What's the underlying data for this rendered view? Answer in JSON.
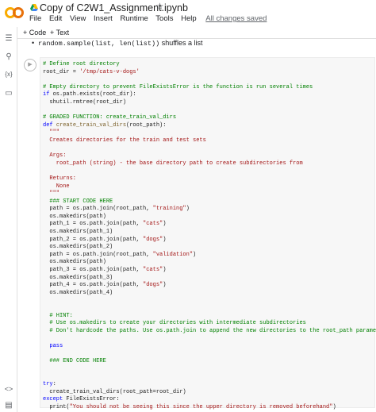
{
  "app": {
    "title": "Copy of C2W1_Assignment.ipynb",
    "star_icon": "star-outline-icon",
    "menu": [
      "File",
      "Edit",
      "View",
      "Insert",
      "Runtime",
      "Tools",
      "Help"
    ],
    "save_status": "All changes saved"
  },
  "toolbar": {
    "add_code": "+ Code",
    "add_text": "+ Text"
  },
  "sidebar": {
    "icons": [
      "table-of-contents-icon",
      "search-icon",
      "variables-icon",
      "files-icon",
      "code-snippets-icon",
      "terminal-icon"
    ]
  },
  "text_cell": {
    "code": "random.sample(list, len(list))",
    "rest": " shuffles a list"
  },
  "code_lines": [
    [
      [
        "cm",
        "# Define root directory"
      ]
    ],
    [
      [
        "",
        "root_dir = "
      ],
      [
        "st",
        "'/tmp/cats-v-dogs'"
      ]
    ],
    [
      [
        "",
        ""
      ]
    ],
    [
      [
        "cm",
        "# Empty directory to prevent FileExistsError is the function is run several times"
      ]
    ],
    [
      [
        "kw",
        "if"
      ],
      [
        "",
        " os.path.exists(root_dir):"
      ]
    ],
    [
      [
        "",
        "  shutil.rmtree(root_dir)"
      ]
    ],
    [
      [
        "",
        ""
      ]
    ],
    [
      [
        "cm",
        "# GRADED FUNCTION: create_train_val_dirs"
      ]
    ],
    [
      [
        "kw",
        "def"
      ],
      [
        "",
        " "
      ],
      [
        "fn",
        "create_train_val_dirs"
      ],
      [
        "",
        "(root_path):"
      ]
    ],
    [
      [
        "st",
        "  \"\"\""
      ]
    ],
    [
      [
        "st",
        "  Creates directories for the train and test sets"
      ]
    ],
    [
      [
        "st",
        ""
      ]
    ],
    [
      [
        "st",
        "  Args:"
      ]
    ],
    [
      [
        "st",
        "    root_path (string) - the base directory path to create subdirectories from"
      ]
    ],
    [
      [
        "st",
        ""
      ]
    ],
    [
      [
        "st",
        "  Returns:"
      ]
    ],
    [
      [
        "st",
        "    None"
      ]
    ],
    [
      [
        "st",
        "  \"\"\""
      ]
    ],
    [
      [
        "cm",
        "  ### START CODE HERE"
      ]
    ],
    [
      [
        "",
        "  path = os.path.join(root_path, "
      ],
      [
        "st",
        "\"training\""
      ],
      [
        "",
        ")"
      ]
    ],
    [
      [
        "",
        "  os.makedirs(path)"
      ]
    ],
    [
      [
        "",
        "  path_1 = os.path.join(path, "
      ],
      [
        "st",
        "\"cats\""
      ],
      [
        "",
        ")"
      ]
    ],
    [
      [
        "",
        "  os.makedirs(path_1)"
      ]
    ],
    [
      [
        "",
        "  path_2 = os.path.join(path, "
      ],
      [
        "st",
        "\"dogs\""
      ],
      [
        "",
        ")"
      ]
    ],
    [
      [
        "",
        "  os.makedirs(path_2)"
      ]
    ],
    [
      [
        "",
        "  path = os.path.join(root_path, "
      ],
      [
        "st",
        "\"validation\""
      ],
      [
        "",
        ")"
      ]
    ],
    [
      [
        "",
        "  os.makedirs(path)"
      ]
    ],
    [
      [
        "",
        "  path_3 = os.path.join(path, "
      ],
      [
        "st",
        "\"cats\""
      ],
      [
        "",
        ")"
      ]
    ],
    [
      [
        "",
        "  os.makedirs(path_3)"
      ]
    ],
    [
      [
        "",
        "  path_4 = os.path.join(path, "
      ],
      [
        "st",
        "\"dogs\""
      ],
      [
        "",
        ")"
      ]
    ],
    [
      [
        "",
        "  os.makedirs(path_4)"
      ]
    ],
    [
      [
        "",
        ""
      ]
    ],
    [
      [
        "",
        ""
      ]
    ],
    [
      [
        "cm",
        "  # HINT:"
      ]
    ],
    [
      [
        "cm",
        "  # Use os.makedirs to create your directories with intermediate subdirectories"
      ]
    ],
    [
      [
        "cm",
        "  # Don't hardcode the paths. Use os.path.join to append the new directories to the root_path parameter"
      ]
    ],
    [
      [
        "",
        ""
      ]
    ],
    [
      [
        "kw",
        "  pass"
      ]
    ],
    [
      [
        "",
        ""
      ]
    ],
    [
      [
        "cm",
        "  ### END CODE HERE"
      ]
    ],
    [
      [
        "",
        ""
      ]
    ],
    [
      [
        "",
        ""
      ]
    ],
    [
      [
        "kw",
        "try"
      ],
      [
        "",
        ":"
      ]
    ],
    [
      [
        "",
        "  create_train_val_dirs(root_path=root_dir)"
      ]
    ],
    [
      [
        "kw",
        "except"
      ],
      [
        "",
        " FileExistsError:"
      ]
    ],
    [
      [
        "",
        "  print("
      ],
      [
        "st",
        "\"You should not be seeing this since the upper directory is removed beforehand\""
      ],
      [
        "",
        ")"
      ]
    ]
  ]
}
